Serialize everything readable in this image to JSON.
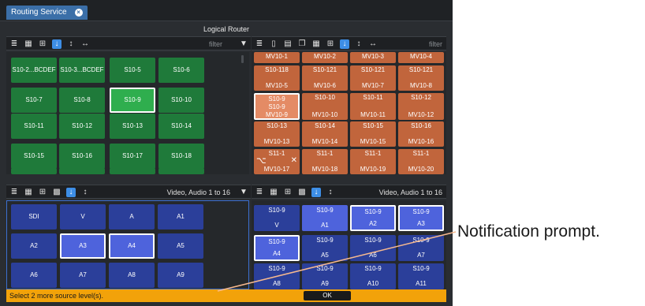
{
  "tab": {
    "label": "Routing Service"
  },
  "window": {
    "title": "Logical Router"
  },
  "top_left_toolbar": {
    "filter_placeholder": "filter"
  },
  "top_right_toolbar": {
    "filter_placeholder": "filter"
  },
  "bottom_left_toolbar": {
    "level_label": "Video, Audio 1 to 16"
  },
  "bottom_right_toolbar": {
    "level_label": "Video, Audio 1 to 16"
  },
  "sources": [
    "S10-2...BCDEF",
    "S10-3...BCDEF",
    "S10-5",
    "S10-6",
    "S10-7",
    "S10-8",
    "S10-9",
    "S10-10",
    "S10-11",
    "S10-12",
    "S10-13",
    "S10-14",
    "S10-15",
    "S10-16",
    "S10-17",
    "S10-18"
  ],
  "selected_source": "S10-9",
  "destinations": [
    {
      "top": "MV10-1",
      "bottom": ""
    },
    {
      "top": "MV10-2",
      "bottom": ""
    },
    {
      "top": "MV10-3",
      "bottom": ""
    },
    {
      "top": "MV10-4",
      "bottom": ""
    },
    {
      "top": "S10-118",
      "bottom": "MV10-5"
    },
    {
      "top": "S10-121",
      "bottom": "MV10-6"
    },
    {
      "top": "S10-121",
      "bottom": "MV10-7"
    },
    {
      "top": "S10-121",
      "bottom": "MV10-8"
    },
    {
      "top": "S10-9\nS10-9",
      "bottom": "MV10-9"
    },
    {
      "top": "S10-10",
      "bottom": "MV10-10"
    },
    {
      "top": "S10-11",
      "bottom": "MV10-11"
    },
    {
      "top": "S10-12",
      "bottom": "MV10-12"
    },
    {
      "top": "S10-13",
      "bottom": "MV10-13"
    },
    {
      "top": "S10-14",
      "bottom": "MV10-14"
    },
    {
      "top": "S10-15",
      "bottom": "MV10-15"
    },
    {
      "top": "S10-16",
      "bottom": "MV10-16"
    },
    {
      "top": "S11-1",
      "bottom": "MV10-17"
    },
    {
      "top": "S11-1",
      "bottom": "MV10-18"
    },
    {
      "top": "S11-1",
      "bottom": "MV10-19"
    },
    {
      "top": "S11-1",
      "bottom": "MV10-20"
    }
  ],
  "source_levels": [
    "SDI",
    "V",
    "A",
    "A1",
    "A2",
    "A3",
    "A4",
    "A5",
    "A6",
    "A7",
    "A8",
    "A9"
  ],
  "selected_source_levels": [
    "A3",
    "A4"
  ],
  "dest_levels": [
    {
      "top": "S10-9",
      "bottom": "V"
    },
    {
      "top": "S10-9",
      "bottom": "A1"
    },
    {
      "top": "S10-9",
      "bottom": "A2"
    },
    {
      "top": "S10-9",
      "bottom": "A3"
    },
    {
      "top": "S10-9",
      "bottom": "A4"
    },
    {
      "top": "S10-9",
      "bottom": "A5"
    },
    {
      "top": "S10-9",
      "bottom": "A6"
    },
    {
      "top": "S10-9",
      "bottom": "A7"
    },
    {
      "top": "S10-9",
      "bottom": "A8"
    },
    {
      "top": "S10-9",
      "bottom": "A9"
    },
    {
      "top": "S10-9",
      "bottom": "A10"
    },
    {
      "top": "S10-9",
      "bottom": "A11"
    }
  ],
  "notification": {
    "message": "Select 2 more source level(s).",
    "ok_label": "OK"
  },
  "annotation": {
    "label": "Notification prompt."
  },
  "colors": {
    "source_button": "#1f7a3a",
    "source_selected": "#2fae4e",
    "destination_button": "#c1653c",
    "destination_selected": "#e48b65",
    "level_button": "#2b3f9a",
    "level_selected": "#4e63dc",
    "notification_bar": "#f2a20a"
  }
}
